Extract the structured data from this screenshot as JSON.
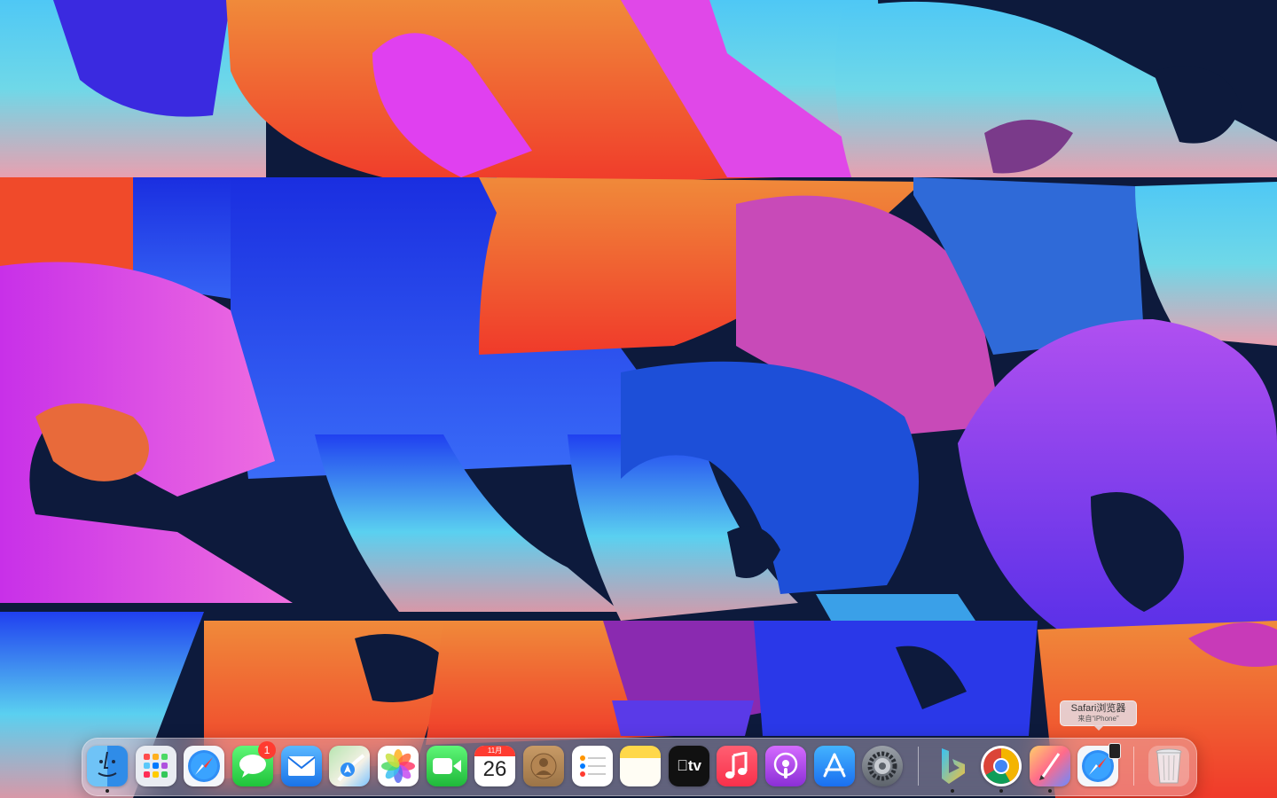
{
  "tooltip": {
    "title": "Safari浏览器",
    "subtitle": "来自“iPhone”"
  },
  "dock": {
    "items": [
      {
        "name": "Finder",
        "icon": "finder-icon"
      },
      {
        "name": "Launchpad",
        "icon": "launchpad-icon"
      },
      {
        "name": "Safari",
        "icon": "safari-icon"
      },
      {
        "name": "Messages",
        "icon": "messages-icon",
        "badge": "1"
      },
      {
        "name": "Mail",
        "icon": "mail-icon"
      },
      {
        "name": "Maps",
        "icon": "maps-icon"
      },
      {
        "name": "Photos",
        "icon": "photos-icon"
      },
      {
        "name": "FaceTime",
        "icon": "facetime-icon"
      },
      {
        "name": "Calendar",
        "icon": "calendar-icon",
        "month": "11月",
        "day": "26"
      },
      {
        "name": "Contacts",
        "icon": "contacts-icon"
      },
      {
        "name": "Reminders",
        "icon": "reminders-icon"
      },
      {
        "name": "Notes",
        "icon": "notes-icon"
      },
      {
        "name": "TV",
        "icon": "tv-icon",
        "label": "tv"
      },
      {
        "name": "Music",
        "icon": "music-icon"
      },
      {
        "name": "Podcasts",
        "icon": "podcasts-icon"
      },
      {
        "name": "App Store",
        "icon": "app-store-icon"
      },
      {
        "name": "System Settings",
        "icon": "gear-icon"
      },
      {
        "name": "Bing",
        "icon": "bing-icon"
      },
      {
        "name": "Chrome",
        "icon": "chrome-icon"
      },
      {
        "name": "Pixelmator",
        "icon": "pixelmator-icon"
      },
      {
        "name": "Safari from iPhone",
        "icon": "safari-iphone-icon"
      },
      {
        "name": "Trash",
        "icon": "trash-icon"
      }
    ]
  },
  "colors": {
    "wallpaper_bg": "#0d1a3c",
    "orange": "#f0622a",
    "magenta": "#e048e8",
    "blue": "#2a4ff0",
    "cyan": "#5ad0f0",
    "purple": "#8a3cf0"
  }
}
